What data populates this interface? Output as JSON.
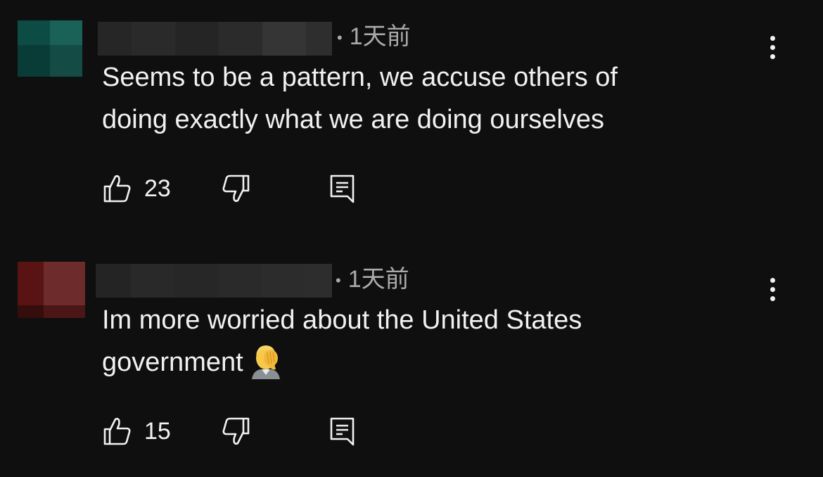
{
  "comments": [
    {
      "timestamp": "1天前",
      "text_lines": [
        "Seems to be a pattern, we accuse others of",
        "doing exactly what we are doing ourselves"
      ],
      "likes": "23",
      "avatar_colors": [
        "#0d4c45",
        "#1a5e55",
        "#0a3b36",
        "#144a44"
      ],
      "has_emoji": false
    },
    {
      "timestamp": "1天前",
      "text_lines": [
        "Im more worried about the United States",
        "government"
      ],
      "likes": "15",
      "avatar_colors": [
        "#5a1212",
        "#6e2a2a",
        "#3a0e0e",
        "#4a1818"
      ],
      "has_emoji": true,
      "emoji_name": "face-palm-emoji"
    }
  ],
  "icons": {
    "like": "thumbs-up-icon",
    "dislike": "thumbs-down-icon",
    "reply": "reply-comment-icon",
    "more": "more-vertical-icon"
  },
  "colors": {
    "background": "#0f0f0f",
    "text": "#f1f1f1",
    "secondary": "#aaaaaa"
  }
}
